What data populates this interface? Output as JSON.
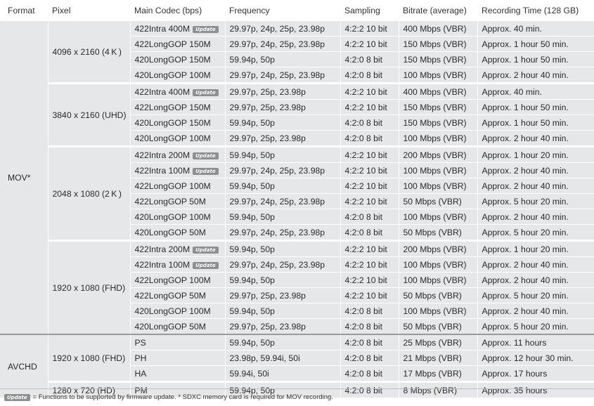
{
  "headers": {
    "format": "Format",
    "pixel": "Pixel",
    "codec": "Main Codec  (bps)",
    "frequency": "Frequency",
    "sampling": "Sampling",
    "bitrate": "Bitrate (average)",
    "recording": "Recording Time  (128 GB)"
  },
  "badge_text": "Update",
  "formats": {
    "mov": "MOV*",
    "avchd": "AVCHD"
  },
  "pixels": {
    "p4k": "4096 x 2160 (4 K )",
    "uhd": "3840 x 2160 (UHD)",
    "p2k": "2048 x 1080 (2 K )",
    "fhd": "1920 x 1080 (FHD)",
    "avchd_fhd": "1920 x 1080 (FHD)",
    "hd": "1280 x 720 (HD)"
  },
  "rows": [
    {
      "codec": "422Intra 400M",
      "update": true,
      "freq": "29.97p, 24p, 25p, 23.98p",
      "sampling": "4:2:2  10 bit",
      "bitrate": "400 Mbps (VBR)",
      "time": "Approx. 40 min."
    },
    {
      "codec": "422LongGOP 150M",
      "update": false,
      "freq": "29.97p, 24p, 25p, 23.98p",
      "sampling": "4:2:2  10 bit",
      "bitrate": "150 Mbps (VBR)",
      "time": "Approx.  1  hour 50 min."
    },
    {
      "codec": "420LongGOP 150M",
      "update": false,
      "freq": "59.94p, 50p",
      "sampling": "4:2:0  8 bit",
      "bitrate": "150 Mbps (VBR)",
      "time": "Approx.  1  hour 50 min."
    },
    {
      "codec": "420LongGOP 100M",
      "update": false,
      "freq": "29.97p, 24p, 25p, 23.98p",
      "sampling": "4:2:0  8 bit",
      "bitrate": "100 Mbps (VBR)",
      "time": "Approx. 2 hour 40 min."
    },
    {
      "codec": "422Intra 400M",
      "update": true,
      "freq": "29.97p, 25p, 23.98p",
      "sampling": "4:2:2  10 bit",
      "bitrate": "400 Mbps (VBR)",
      "time": "Approx. 40 min."
    },
    {
      "codec": "422LongGOP 150M",
      "update": false,
      "freq": "29.97p, 25p, 23.98p",
      "sampling": "4:2:2  10 bit",
      "bitrate": "150 Mbps (VBR)",
      "time": "Approx.  1  hour 50 min."
    },
    {
      "codec": "420LongGOP 150M",
      "update": false,
      "freq": "59.94p, 50p",
      "sampling": "4:2:0  8 bit",
      "bitrate": "150 Mbps (VBR)",
      "time": "Approx.  1  hour 50 min."
    },
    {
      "codec": "420LongGOP 100M",
      "update": false,
      "freq": "29.97p, 25p, 23.98p",
      "sampling": "4:2:0  8 bit",
      "bitrate": "100 Mbps (VBR)",
      "time": "Approx. 2 hour 40 min."
    },
    {
      "codec": "422Intra 200M",
      "update": true,
      "freq": "59.94p, 50p",
      "sampling": "4:2:2  10 bit",
      "bitrate": "200 Mbps (VBR)",
      "time": "Approx.  1  hour 20 min."
    },
    {
      "codec": "422Intra 100M",
      "update": true,
      "freq": "29.97p, 24p, 25p, 23.98p",
      "sampling": "4:2:2  10 bit",
      "bitrate": "100 Mbps (VBR)",
      "time": "Approx. 2 hour 40 min."
    },
    {
      "codec": "422LongGOP 100M",
      "update": false,
      "freq": "59.94p, 50p",
      "sampling": "4:2:2  10 bit",
      "bitrate": "100 Mbps (VBR)",
      "time": "Approx. 2 hour 40 min."
    },
    {
      "codec": "422LongGOP  50M",
      "update": false,
      "freq": "29.97p, 24p, 25p, 23.98p",
      "sampling": "4:2:2  10 bit",
      "bitrate": "50 Mbps (VBR)",
      "time": "Approx. 5 hour 20 min."
    },
    {
      "codec": "420LongGOP 100M",
      "update": false,
      "freq": "59.94p, 50p",
      "sampling": "4:2:0  8 bit",
      "bitrate": "100 Mbps (VBR)",
      "time": "Approx. 2 hour 40 min."
    },
    {
      "codec": "420LongGOP 50M",
      "update": false,
      "freq": "29.97p, 24p, 25p, 23.98p",
      "sampling": "4:2:0  8 bit",
      "bitrate": "50 Mbps (VBR)",
      "time": "Approx. 5 hour 20 min."
    },
    {
      "codec": "422Intra 200M",
      "update": true,
      "freq": "59.94p, 50p",
      "sampling": "4:2:2  10 bit",
      "bitrate": "200 Mbps (VBR)",
      "time": "Approx.  1  hour 20 min."
    },
    {
      "codec": "422Intra 100M",
      "update": true,
      "freq": "29.97p, 24p, 25p, 23.98p",
      "sampling": "4:2:2  10 bit",
      "bitrate": "100 Mbps (VBR)",
      "time": "Approx. 2 hour 40 min."
    },
    {
      "codec": "422LongGOP 100M",
      "update": false,
      "freq": "59.94p, 50p",
      "sampling": "4:2:2  10 bit",
      "bitrate": "100 Mbps (VBR)",
      "time": "Approx. 2 hour 40 min."
    },
    {
      "codec": "422LongGOP 50M",
      "update": false,
      "freq": "29.97p, 25p, 23.98p",
      "sampling": "4:2:2  10 bit",
      "bitrate": "50 Mbps (VBR)",
      "time": "Approx. 5 hour 20 min."
    },
    {
      "codec": "420LongGOP 100M",
      "update": false,
      "freq": "59.94p, 50p",
      "sampling": "4:2:0  8 bit",
      "bitrate": "100 Mbps (VBR)",
      "time": "Approx. 2 hour 40 min."
    },
    {
      "codec": "420LongGOP 50M",
      "update": false,
      "freq": "29.97p, 25p, 23.98p",
      "sampling": "4:2:0  8 bit",
      "bitrate": "50 Mbps (VBR)",
      "time": "Approx. 5 hour 20 min."
    },
    {
      "codec": "PS",
      "update": false,
      "freq": "59.94p, 50p",
      "sampling": "4:2:0  8 bit",
      "bitrate": "25 Mbps (VBR)",
      "time": "Approx. 11 hours"
    },
    {
      "codec": "PH",
      "update": false,
      "freq": "23.98p, 59.94i, 50i",
      "sampling": "4:2:0  8 bit",
      "bitrate": "21 Mbps (VBR)",
      "time": "Approx. 12 hour 30 min."
    },
    {
      "codec": "HA",
      "update": false,
      "freq": "59.94i, 50i",
      "sampling": "4:2:0  8 bit",
      "bitrate": "17 Mbps (VBR)",
      "time": "Approx. 17 hours"
    },
    {
      "codec": "PM",
      "update": false,
      "freq": "59.94p, 50p",
      "sampling": "4:2:0  8 bit",
      "bitrate": "8 Mbps (VBR)",
      "time": "Approx. 35 hours"
    }
  ],
  "footnote": {
    "badge": "Update",
    "text": "= Functions to be supported by firmware update.  * SDXC memory card is required for MOV recording."
  },
  "colors": {
    "cell_bg": "#e6e7e8",
    "badge_bg": "#8e8f91",
    "text": "#2a2a2a"
  }
}
